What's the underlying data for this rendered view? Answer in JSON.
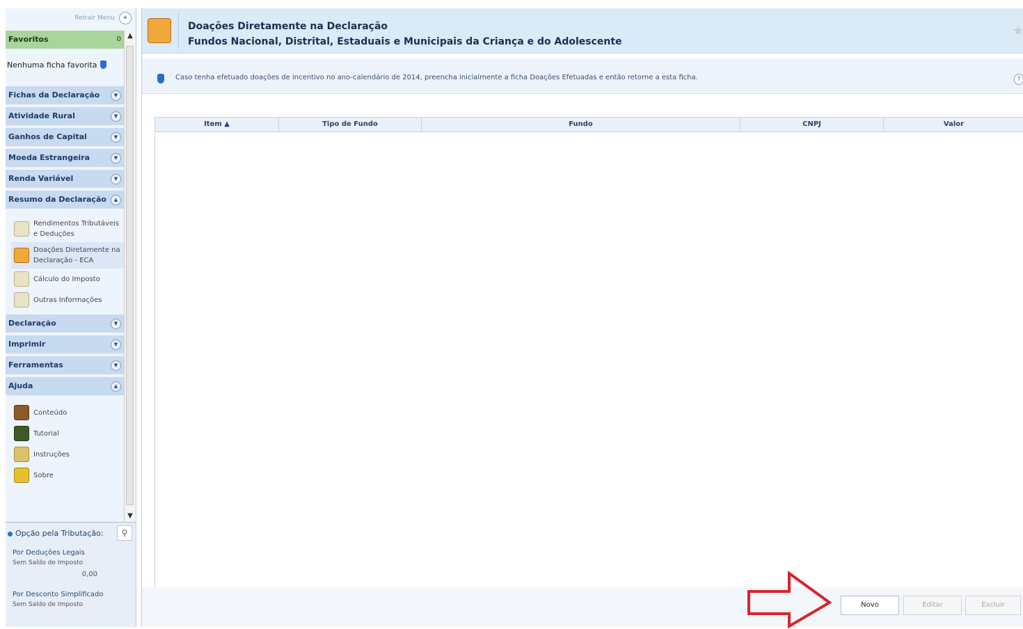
{
  "sidebar": {
    "retract_label": "Retrair Menu",
    "favorites": {
      "label": "Favoritos",
      "count": "0",
      "empty_text": "Nenhuma ficha favorita"
    },
    "groups_top": [
      {
        "label": "Fichas da Declaração"
      },
      {
        "label": "Atividade Rural"
      },
      {
        "label": "Ganhos de Capital"
      },
      {
        "label": "Moeda Estrangeira"
      },
      {
        "label": "Renda Variável"
      },
      {
        "label": "Resumo da Declaração"
      }
    ],
    "resumo_items": [
      {
        "label": "Rendimentos Tributáveis e Deduções",
        "icon": "money-bag-icon"
      },
      {
        "label": "Doações Diretamente na Declaração - ECA",
        "icon": "house-icon"
      },
      {
        "label": "Cálculo do Imposto",
        "icon": "calculator-icon"
      },
      {
        "label": "Outras Informações",
        "icon": "info-doc-icon"
      }
    ],
    "groups_bottom": [
      {
        "label": "Declaração"
      },
      {
        "label": "Imprimir"
      },
      {
        "label": "Ferramentas"
      },
      {
        "label": "Ajuda"
      }
    ],
    "ajuda_items": [
      {
        "label": "Conteúdo",
        "icon": "book-icon"
      },
      {
        "label": "Tutorial",
        "icon": "tutorial-icon"
      },
      {
        "label": "Instruções",
        "icon": "instructions-icon"
      },
      {
        "label": "Sobre",
        "icon": "about-icon"
      }
    ]
  },
  "tax_option": {
    "title": "Opção pela Tributação:",
    "legal": {
      "label": "Por Deduções Legais",
      "balance_label": "Sem Saldo de Imposto",
      "balance_value": "0,00"
    },
    "simplified": {
      "label": "Por Desconto Simplificado",
      "balance_label": "Sem Saldo de Imposto"
    }
  },
  "main": {
    "title_line1": "Doações Diretamente na Declaração",
    "title_line2": "Fundos Nacional, Distrital, Estaduais e Municipais da Criança e do Adolescente",
    "info_text": "Caso tenha efetuado doações de incentivo no ano-calendário de 2014, preencha inicialmente a ficha Doações Efetuadas e então retorne a esta ficha.",
    "table_columns": [
      "Item ▲",
      "Tipo de Fundo",
      "Fundo",
      "CNPJ",
      "Valor"
    ],
    "buttons": {
      "new": "Novo",
      "edit": "Editar",
      "delete": "Excluir"
    }
  },
  "colors": {
    "accent_arrow": "#d8232a",
    "sidebar_group": "#c8daf0",
    "favorites_group": "#a9d49b",
    "header_bg": "#dbeaf7"
  }
}
